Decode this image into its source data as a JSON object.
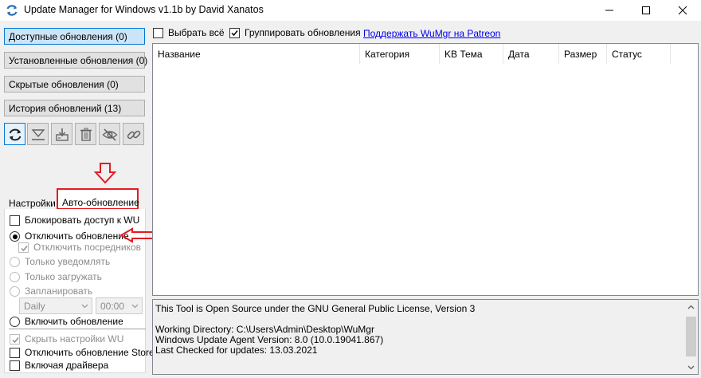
{
  "window": {
    "title": "Update Manager for Windows v1.1b by David Xanatos"
  },
  "sidebar": {
    "buttons": [
      {
        "label": "Доступные обновления (0)",
        "active": true
      },
      {
        "label": "Установленные обновления (0)",
        "active": false
      },
      {
        "label": "Скрытые обновления (0)",
        "active": false
      },
      {
        "label": "История обновлений (13)",
        "active": false
      }
    ],
    "tools": [
      "refresh-icon",
      "download-icon",
      "install-icon",
      "delete-icon",
      "hide-icon",
      "link-icon"
    ]
  },
  "tabs": {
    "settings": "Настройки",
    "auto_update": "Авто-обновление"
  },
  "options": {
    "block_wu": "Блокировать доступ к WU",
    "disable_update": "Отключить обновление",
    "disable_mediators": "Отключить посредников",
    "notify_only": "Только уведомлять",
    "download_only": "Только загружать",
    "scheduled": "Запланировать",
    "schedule_day": "Daily",
    "schedule_time": "00:00",
    "enable_update": "Включить обновление",
    "hide_wu_settings": "Скрыть настройки WU",
    "disable_store_update": "Отключить обновление Store",
    "include_drivers": "Включая драйвера"
  },
  "top": {
    "select_all": "Выбрать всё",
    "group_updates": "Группировать обновления",
    "patreon_link": "Поддержать WuMgr на Patreon"
  },
  "grid": {
    "columns": [
      "Название",
      "Категория",
      "KB Тема",
      "Дата",
      "Размер",
      "Статус"
    ]
  },
  "log": {
    "lines": [
      "This Tool is Open Source under the GNU General Public License, Version 3",
      "",
      "Working Directory: C:\\Users\\Admin\\Desktop\\WuMgr",
      "Windows Update Agent Version: 8.0 (10.0.19041.867)",
      "Last Checked for updates: 13.03.2021"
    ]
  },
  "colors": {
    "accent": "#0078d7",
    "annotation_red": "#e31b23",
    "link": "#0000ee"
  }
}
